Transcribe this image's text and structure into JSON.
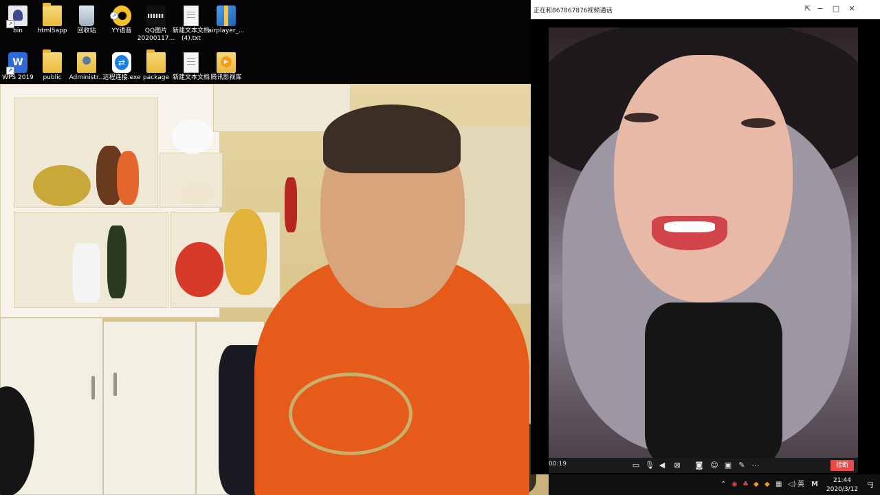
{
  "desktop": {
    "icons": [
      {
        "label": "bin",
        "icon": "bin-folder-icon"
      },
      {
        "label": "html5app",
        "icon": "folder-icon"
      },
      {
        "label": "回收站",
        "icon": "recycle-bin-icon"
      },
      {
        "label": "YY语音",
        "icon": "yy-voice-icon"
      },
      {
        "label": "QQ图片\n20200117...",
        "icon": "image-file-icon"
      },
      {
        "label": "新建文本文档\n(4).txt",
        "icon": "text-file-icon"
      },
      {
        "label": "airplayer_...",
        "icon": "archive-icon"
      },
      {
        "label": "WPS 2019",
        "icon": "wps-icon"
      },
      {
        "label": "public",
        "icon": "folder-icon"
      },
      {
        "label": "Administr...",
        "icon": "user-folder-icon"
      },
      {
        "label": "远程连接.exe",
        "icon": "teamviewer-icon"
      },
      {
        "label": "package",
        "icon": "folder-icon"
      },
      {
        "label": "新建文本文档",
        "icon": "text-file-icon"
      },
      {
        "label": "腾讯影视库",
        "icon": "tencent-video-icon"
      }
    ]
  },
  "call_window": {
    "title": "正在和867867876视频通话",
    "elapsed": "00:19",
    "hangup_label": "挂断",
    "titlebar_icons": [
      "pin-icon",
      "minimize-icon",
      "maximize-icon",
      "close-icon"
    ],
    "controls": [
      "chat-icon",
      "microphone-icon",
      "speaker-icon",
      "camera-off-icon",
      "screenshot-icon",
      "effects-icon",
      "screen-share-icon",
      "whiteboard-icon",
      "more-icon"
    ]
  },
  "taskbar": {
    "tray_icons": [
      "show-hidden-icons",
      "security-icon",
      "app-icon",
      "app-icon",
      "app-icon",
      "network-icon",
      "volume-icon"
    ],
    "ime": "英",
    "ime_mode": "M",
    "time": "21:44",
    "date": "2020/3/12",
    "notifications": "2"
  }
}
